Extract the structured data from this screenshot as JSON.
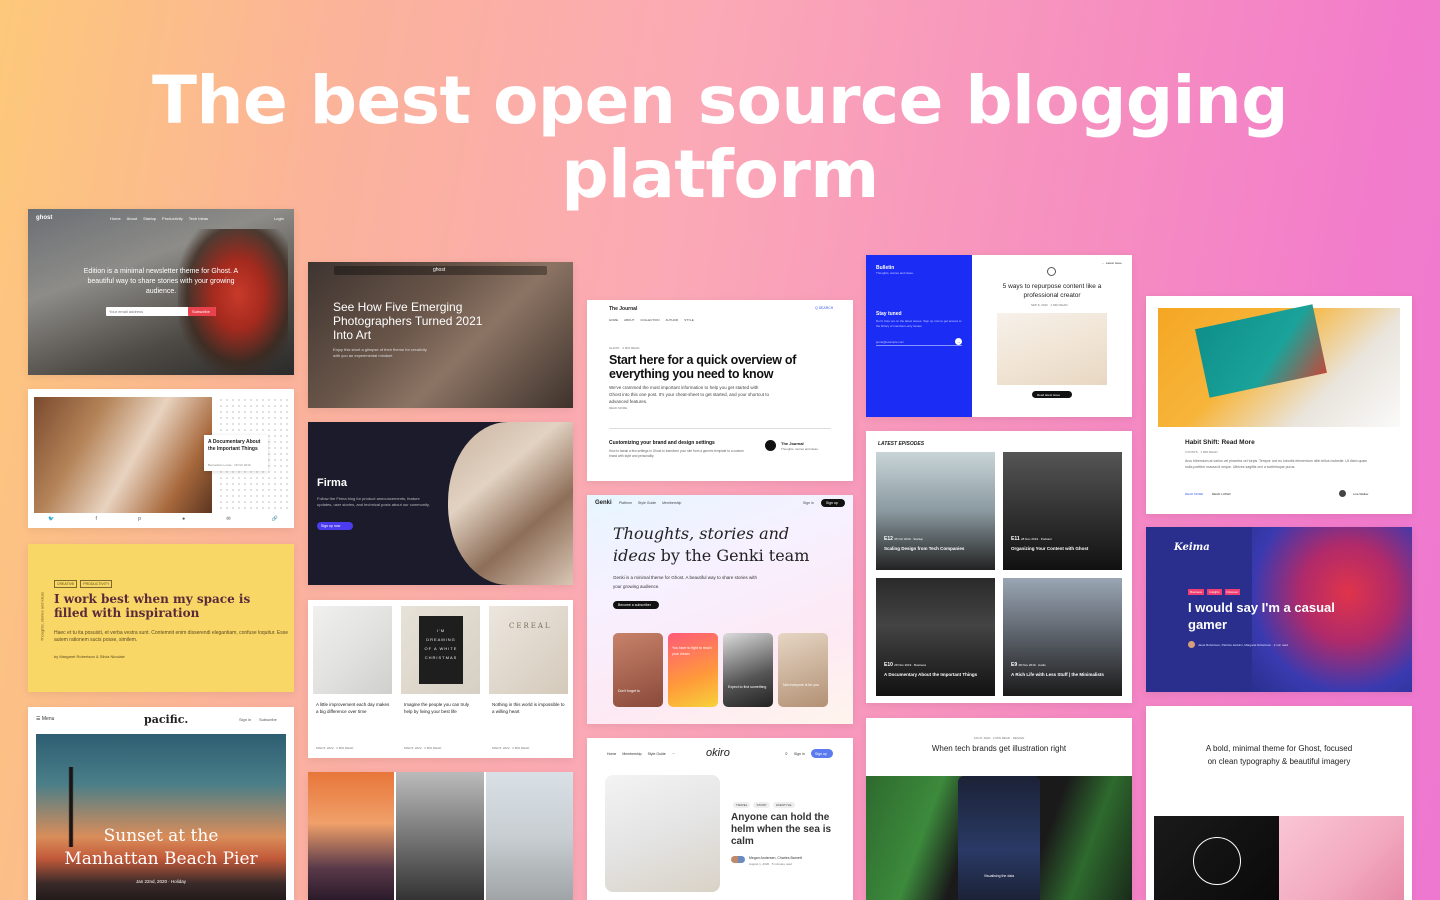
{
  "hero": {
    "title_line1": "The best open source blogging",
    "title_line2": "platform"
  },
  "edition": {
    "logo": "ghost",
    "nav": [
      "Home",
      "About",
      "Startup",
      "Productivity",
      "Tech Ideas"
    ],
    "login": "Login",
    "tagline": "Edition is a minimal newsletter theme for Ghost. A beautiful way to share stories with your growing audience.",
    "email_placeholder": "Your email address",
    "subscribe": "Subscribe"
  },
  "documentary": {
    "title": "A Documentary About the Important Things",
    "meta": "Bernadette Lucas · 18 Oct 2019"
  },
  "yellow": {
    "tags": [
      "CREATIVE",
      "PRODUCTIVITY"
    ],
    "side": "Thoughts, stories and ideas",
    "headline": "I work best when my space is filled with inspiration",
    "excerpt": "Haec et tu ita posuisti, et verba vestra sunt. Contemnit enim disserendi elegantiam, confuse loquitur. Esse autem rationem sucis posse, similem.",
    "byline": "by Margaret Robertson & Silvia Nicolaie"
  },
  "pacific": {
    "menu": "Menu",
    "logo": "pacific.",
    "signin": "Sign in",
    "subscribe": "Subscribe",
    "title_line1": "Sunset at the",
    "title_line2": "Manhattan Beach Pier",
    "date": "Jan 22nd, 2020",
    "tag": "Holiday"
  },
  "photographers": {
    "title": "See How Five Emerging Photographers Turned 2021 Into Art",
    "excerpt": "Enjoy this short a glimpse of their theme for creativity with you an experimental mindset",
    "logo": "ghost"
  },
  "firma": {
    "title": "Firma",
    "desc": "Follow the Firma blog for product announcements, feature updates, user stories, and technical posts about our community.",
    "button": "Sign up now"
  },
  "grid3": {
    "items": [
      {
        "title": "A little improvement each day makes a big difference over time",
        "date": "MAR 8, 2022",
        "read": "2 MIN READ"
      },
      {
        "title": "Imagine the people you can truly help by living your best life",
        "date": "MAR 8, 2022",
        "read": "2 MIN READ"
      },
      {
        "title": "Nothing in this world is impossible to a willing heart",
        "date": "MAR 8, 2022",
        "read": "2 MIN READ"
      }
    ],
    "letterboard": "I'M DREAMING OF A WHITE CHRISTMAS",
    "book": "CEREAL"
  },
  "journal": {
    "logo": "The Journal",
    "nav": [
      "HOME",
      "ABOUT",
      "COLLECTION",
      "AUTHOR",
      "STYLE"
    ],
    "search": "Q SEARCH",
    "kicker": "GHOST · 4 MIN READ",
    "title": "Start here for a quick overview of everything you need to know",
    "excerpt": "We've crammed the most important information to help you get started with Ghost into this one post. It's your cheat-sheet to get started, and your shortcut to advanced features.",
    "more": "READ MORE",
    "sub_title": "Customizing your brand and design settings",
    "sub_excerpt": "How to tweak a few settings in Ghost to transform your site from a generic template to a custom brand with style and personality.",
    "author_name": "The Journal",
    "author_desc": "Thoughts, stories and ideas."
  },
  "genki": {
    "logo": "Genki",
    "nav": [
      "Platform",
      "Style Guide",
      "Membership"
    ],
    "signin": "Sign in",
    "signup": "Sign up",
    "headline_a": "Thoughts, stories and",
    "headline_b": "ideas",
    "headline_c": "by the Genki team",
    "desc": "Genki is a minimal theme for Ghost. A beautiful way to share stories with your growing audience.",
    "button": "Become a subscriber",
    "tiles": [
      "Don't forget to",
      "You have to fight to reach your dream",
      "Expect to find something",
      "Not everyone is for you"
    ]
  },
  "okiro": {
    "nav": [
      "Home",
      "Membership",
      "Style Guide",
      "···"
    ],
    "logo": "okiro",
    "signin": "Sign in",
    "signup": "Sign up",
    "tags": [
      "TRAVEL",
      "STORY",
      "LIFESTYLE"
    ],
    "title": "Anyone can hold the helm when the sea is calm",
    "authors": "Megan Andersen, Charles Barnett",
    "meta": "August 1, 2020 · 5 minutes read"
  },
  "bulletin": {
    "logo": "Bulletin",
    "tag": "Thoughts, stories and ideas.",
    "stay": "Stay tuned",
    "stay_desc": "Don't miss out on the latest issues. Sign up now to get access to the library of members-only issues.",
    "email": "jamie@example.com",
    "latest": "← Latest issue",
    "title": "5 ways to repurpose content like a professional creator",
    "meta": "SEP 8, 2022 · 1 MIN READ",
    "button": "Read latest issue"
  },
  "episodes": {
    "header": "LATEST EPISODES",
    "items": [
      {
        "num": "E12",
        "meta": "05 Oct 2019 · Startup",
        "title": "Scaling Design from Tech Companies"
      },
      {
        "num": "E11",
        "meta": "28 Nov 2019 · Podcast",
        "title": "Organizing Your Content with Ghost"
      },
      {
        "num": "E10",
        "meta": "28 Nov 2019 · Business",
        "title": "A Documentary About the Important Things"
      },
      {
        "num": "E9",
        "meta": "28 Nov 2019 · Audio",
        "title": "A Rich Life with Less Stuff | the Minimalists"
      }
    ]
  },
  "illustration": {
    "kicker": "JAN 8, 2020 · 2 MIN READ · DESIGN",
    "title": "When tech brands get illustration right",
    "caption": "Visualising the data"
  },
  "habit": {
    "title": "Habit Shift: Read More",
    "meta": "3 POSTS · 1 MIN READ",
    "excerpt": "Arcu bibendum at varius vel pharetra vel turpis. Tempor orci eu lobortis elementum nibh tellus molestie. Ut diam quam nulla porttitor massa id neque. Ultrices sagittis orci a scelerisque purus.",
    "readmore": "READ MORE",
    "readlater": "READ LATER",
    "author": "Lisa Walker"
  },
  "keima": {
    "logo": "Keima",
    "tags": [
      "Business",
      "Insights",
      "Discover"
    ],
    "title": "I would say I'm a casual gamer",
    "authors": "Janet Robertson, Patricia Jenkins, Margaret Robertson · 2 min read"
  },
  "minimal": {
    "desc": "A bold, minimal theme for Ghost, focused on clean typography & beautiful imagery"
  },
  "colors": {
    "bulletin_blue": "#1b2cf5",
    "firma_purple": "#4b3cf0",
    "keima_navy": "#2a2f8e",
    "subscribe_red": "#e8424e",
    "keima_tag_pink": "#ef3e72"
  }
}
